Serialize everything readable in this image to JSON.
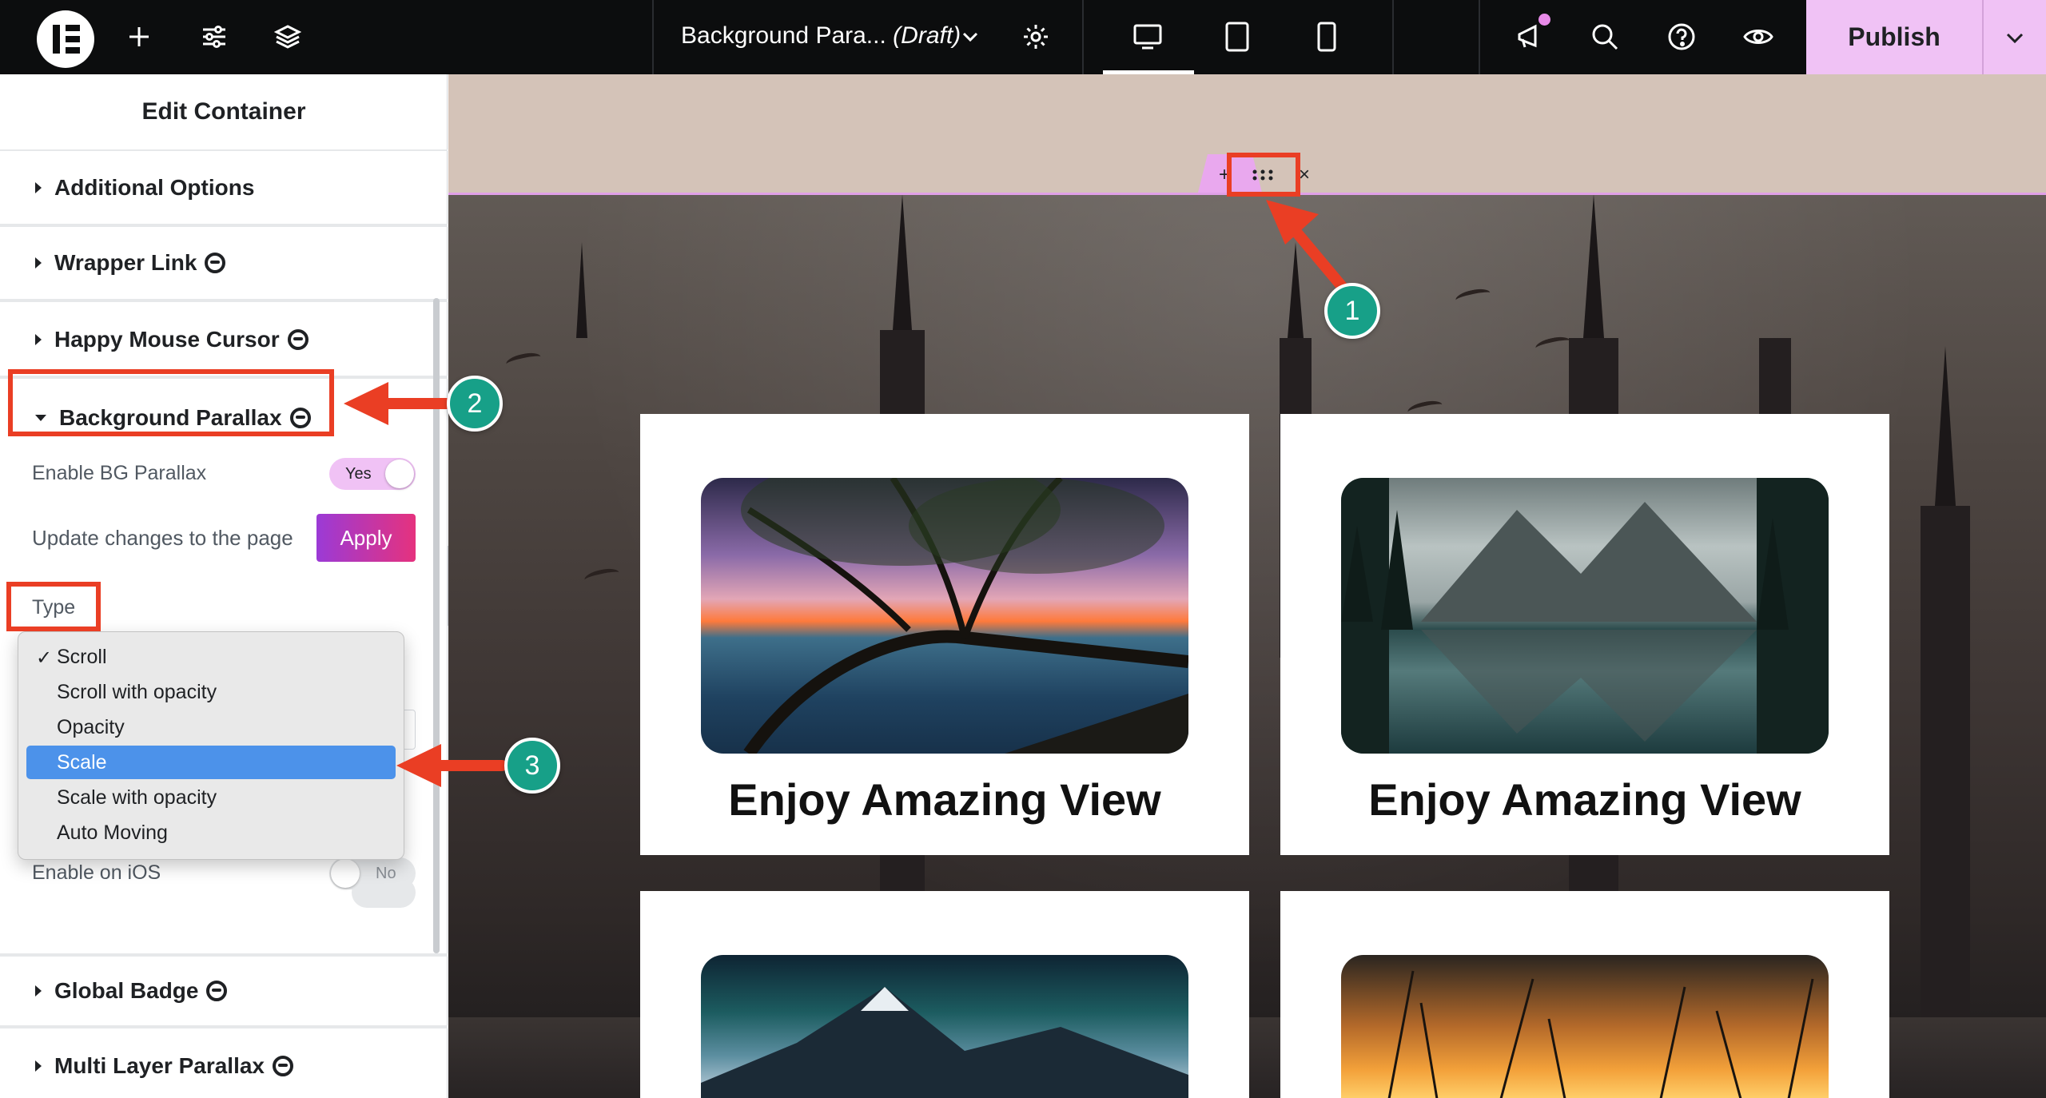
{
  "topbar": {
    "document_title": "Background Para...",
    "document_status": "(Draft)",
    "publish_label": "Publish"
  },
  "panel": {
    "title": "Edit Container",
    "sections": {
      "additional_options": "Additional Options",
      "wrapper_link": "Wrapper Link",
      "happy_mouse_cursor": "Happy Mouse Cursor",
      "background_parallax": "Background Parallax",
      "global_badge": "Global Badge",
      "multi_layer_parallax": "Multi Layer Parallax"
    },
    "enable_bg_parallax": {
      "label": "Enable BG Parallax",
      "value": "Yes"
    },
    "update_changes": {
      "label": "Update changes to the page",
      "button": "Apply"
    },
    "type": {
      "label": "Type",
      "selected_checkmark": "Scroll",
      "options": [
        "Scroll",
        "Scroll with opacity",
        "Opacity",
        "Scale",
        "Scale with opacity",
        "Auto Moving"
      ],
      "highlighted": "Scale"
    },
    "enable_on_ios": {
      "label": "Enable on iOS",
      "value": "No"
    }
  },
  "canvas": {
    "cards": [
      {
        "title": "Enjoy Amazing View"
      },
      {
        "title": "Enjoy Amazing View"
      }
    ]
  },
  "annotations": {
    "step1": "1",
    "step2": "2",
    "step3": "3"
  },
  "colors": {
    "accent_pink": "#f0c2f5",
    "annotation_red": "#ea3e24",
    "step_badge_teal": "#17a088",
    "dropdown_selection": "#4c92ea"
  }
}
